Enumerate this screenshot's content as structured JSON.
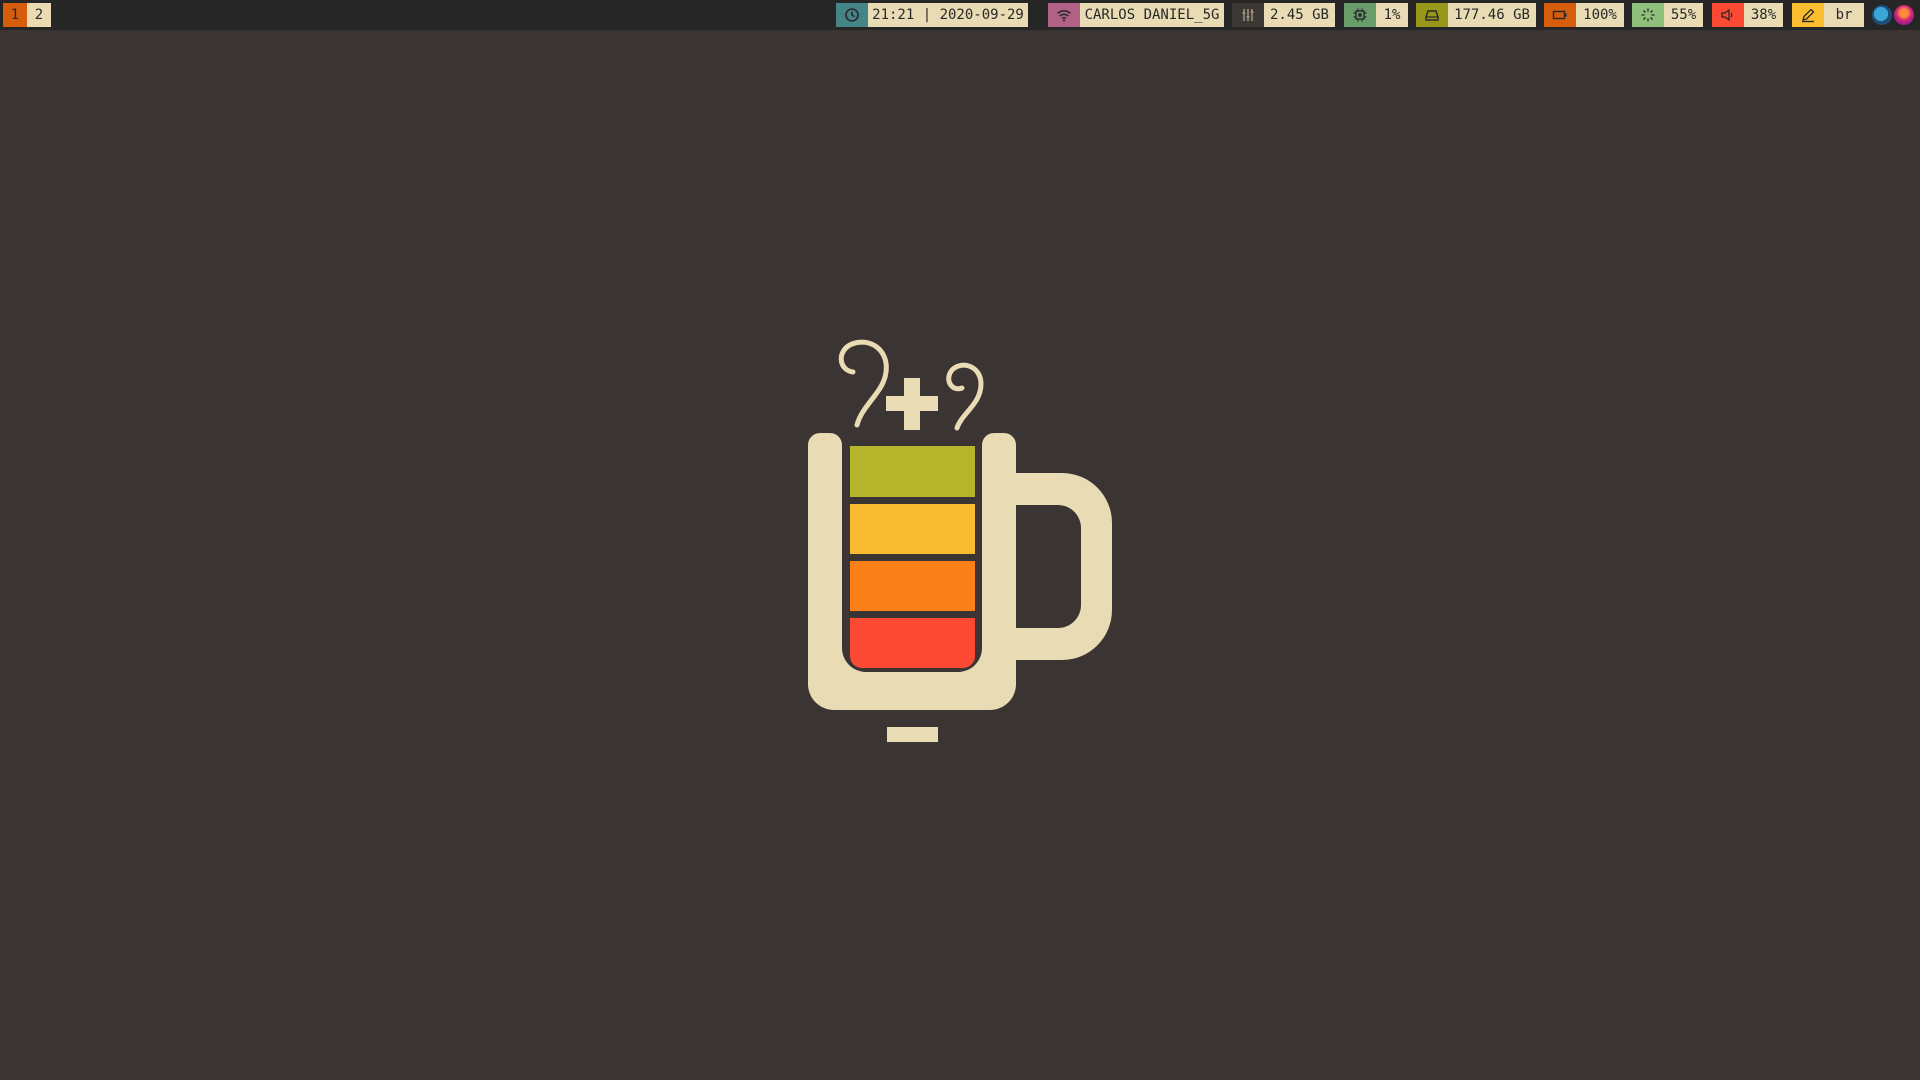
{
  "workspaces": [
    {
      "label": "1",
      "active": true
    },
    {
      "label": "2",
      "active": false
    }
  ],
  "status_modules": {
    "clock": {
      "icon": "clock-icon",
      "text": "21:21 | 2020-09-29",
      "color": "#458588"
    },
    "wifi": {
      "icon": "wifi-icon",
      "text": "CARLOS DANIEL_5G",
      "color": "#b16286"
    },
    "memory": {
      "icon": "memory-icon",
      "text": "2.45 GB",
      "color": "#3c3836"
    },
    "cpu": {
      "icon": "cpu-icon",
      "text": "1%",
      "color": "#689d6a"
    },
    "disk": {
      "icon": "disk-icon",
      "text": "177.46 GB",
      "color": "#98971a"
    },
    "battery": {
      "icon": "battery-icon",
      "text": "100%",
      "color": "#d65d0e"
    },
    "brightness": {
      "icon": "brightness-icon",
      "text": "55%",
      "color": "#8ec07c"
    },
    "volume": {
      "icon": "volume-icon",
      "text": "38%",
      "color": "#fb4934"
    },
    "keyboard": {
      "icon": "pencil-icon",
      "text": "br",
      "color": "#fabd2f"
    }
  },
  "tray": [
    "tray-app-icon",
    "tray-app-icon"
  ],
  "wallpaper": {
    "logo": "battery-mug-logo",
    "background": "#3a3533",
    "logo_color": "#e9dbb4",
    "level_colors": [
      "#b5b42a",
      "#f8bb30",
      "#fc8019",
      "#fb4934"
    ]
  }
}
